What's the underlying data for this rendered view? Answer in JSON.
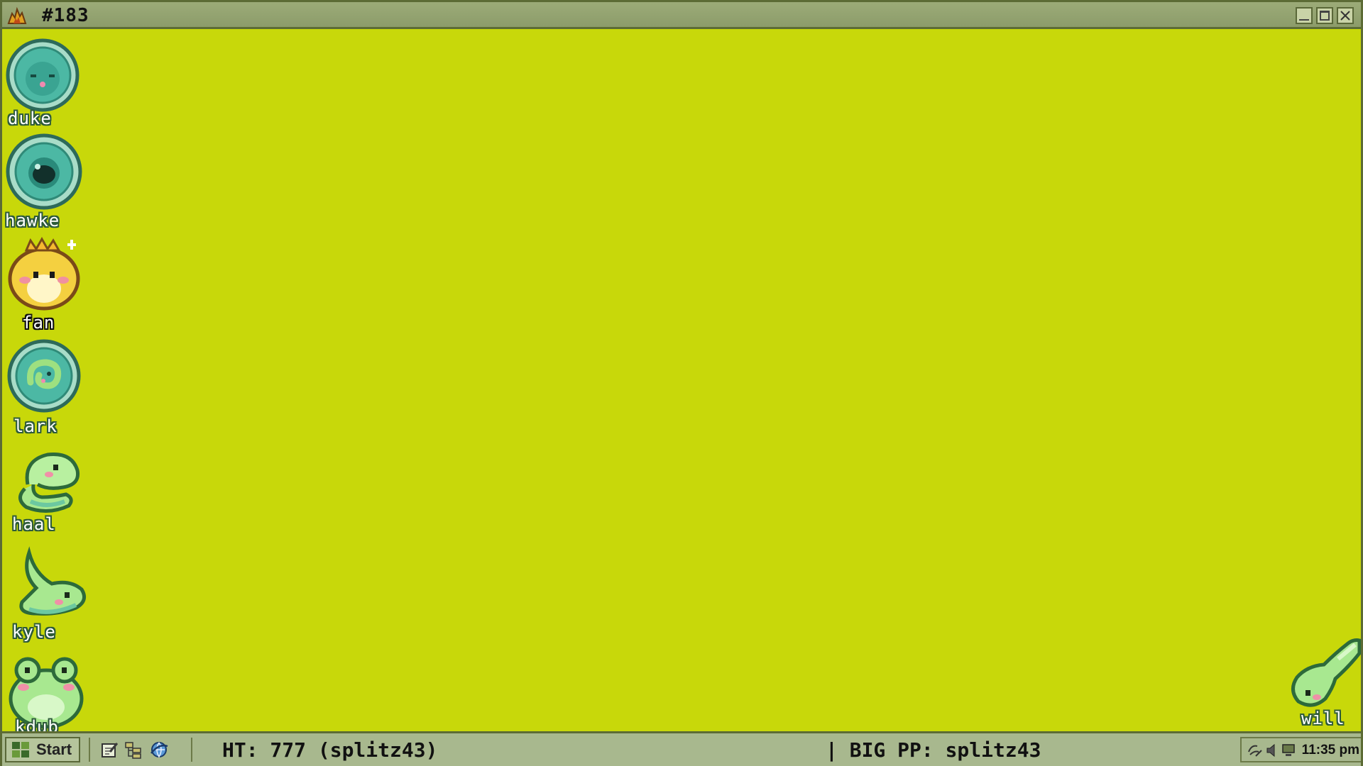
{
  "window": {
    "title": "#183",
    "title_icon": "flame-icon",
    "controls": [
      "minimize-icon",
      "maximize-icon",
      "close-icon"
    ]
  },
  "desktop": {
    "background_color": "#c8d80a",
    "sprites": [
      {
        "label": "duke",
        "icon": "teal-egg-sleeping-icon"
      },
      {
        "label": "hawke",
        "icon": "teal-egg-dark-core-icon"
      },
      {
        "label": "fan",
        "icon": "yellow-chick-crown-icon"
      },
      {
        "label": "lark",
        "icon": "teal-egg-curled-icon"
      },
      {
        "label": "haal",
        "icon": "green-snake-icon"
      },
      {
        "label": "kyle",
        "icon": "green-lizard-icon"
      },
      {
        "label": "kdub",
        "icon": "green-frog-icon"
      },
      {
        "label": "will",
        "icon": "green-tadpole-icon"
      }
    ]
  },
  "taskbar": {
    "start_label": "Start",
    "quick_launch": [
      "notepad-icon",
      "folder-tree-icon",
      "browser-icon"
    ],
    "status_left": "HT: 777 (splitz43)",
    "status_right": "| BIG PP: splitz43",
    "tray_icons": [
      "network-icon",
      "volume-icon",
      "computer-icon"
    ],
    "clock": "11:35 pm"
  },
  "colors": {
    "desktop": "#c8d80a",
    "titlebar": "#94a470",
    "taskbar": "#a8b88e",
    "border": "#5c6b35"
  }
}
